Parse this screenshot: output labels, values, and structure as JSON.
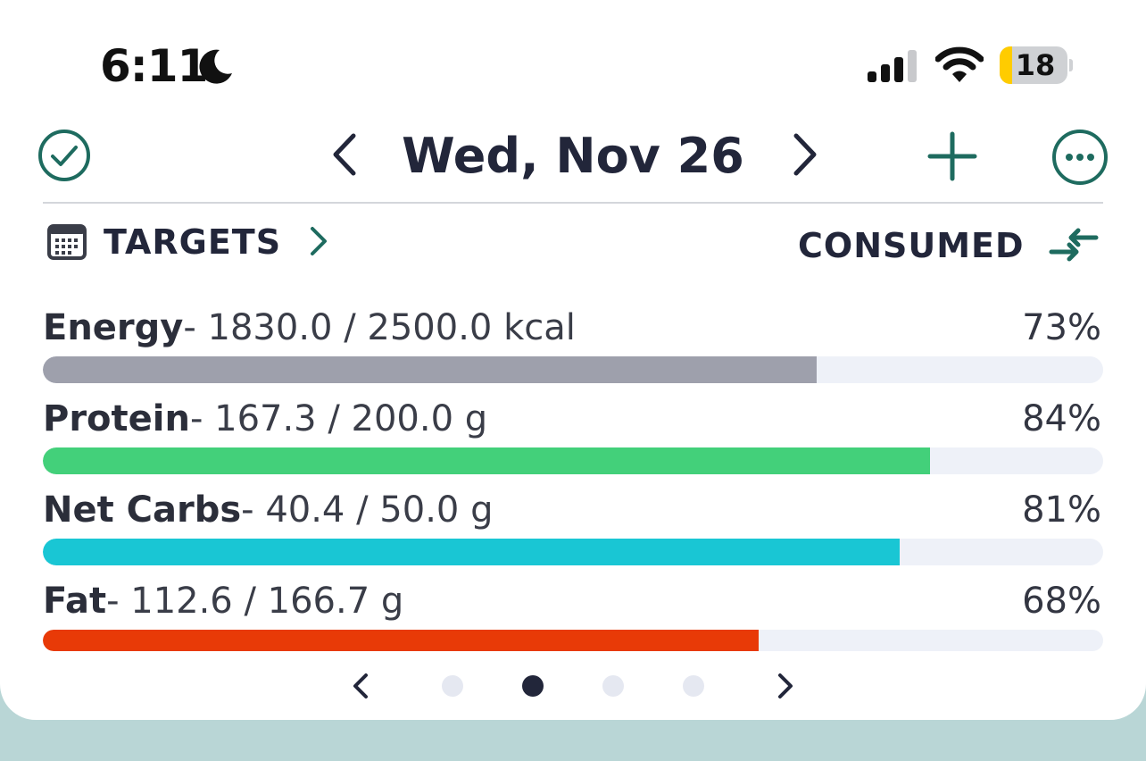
{
  "status_bar": {
    "time": "6:11",
    "battery_level": "18",
    "icons": [
      "moon-icon",
      "signal-icon",
      "wifi-icon",
      "battery-icon"
    ]
  },
  "header": {
    "date": "Wed, Nov 26",
    "icons": [
      "check-circle-icon",
      "chevron-left-icon",
      "chevron-right-icon",
      "plus-icon",
      "more-icon"
    ]
  },
  "targets": {
    "label": "TARGETS",
    "mode_label": "CONSUMED",
    "icons": [
      "calendar-icon",
      "chevron-right-icon",
      "swap-icon"
    ]
  },
  "nutrients": [
    {
      "name": "Energy",
      "amounts": "- 1830.0 / 2500.0 kcal",
      "percent": "73%",
      "fraction": 0.73,
      "color": "#9ea0ac"
    },
    {
      "name": "Protein",
      "amounts": "- 167.3 / 200.0 g",
      "percent": "84%",
      "fraction": 0.837,
      "color": "#43d07a"
    },
    {
      "name": "Net Carbs",
      "amounts": "- 40.4 / 50.0 g",
      "percent": "81%",
      "fraction": 0.808,
      "color": "#19c6d4"
    },
    {
      "name": "Fat",
      "amounts": "- 112.6 / 166.7 g",
      "percent": "68%",
      "fraction": 0.675,
      "color": "#e83a07"
    }
  ],
  "pager": {
    "page_count": 4,
    "active_page": 2
  },
  "colors": {
    "accent": "#1e6b5f",
    "text": "#22263a",
    "background": "#b9d6d6"
  }
}
